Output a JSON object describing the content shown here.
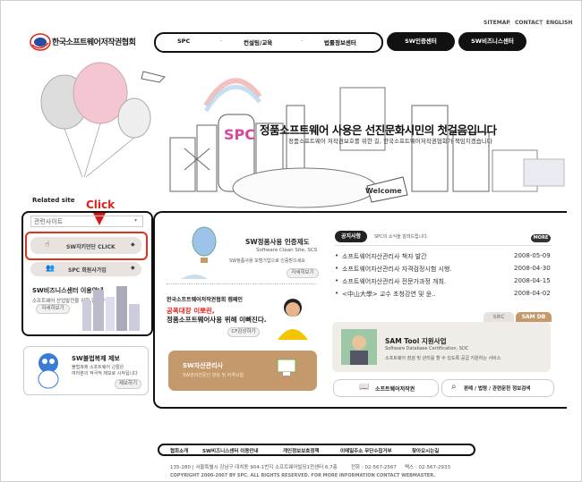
{
  "util_links": [
    "SITEMAP",
    "CONTACT",
    "ENGLISH"
  ],
  "logo_text": "한국소프트웨어저작권협회",
  "nav": {
    "items": [
      "SPC",
      "컨설팅/교육",
      "법률정보센터"
    ]
  },
  "pills": [
    "SW인증센터",
    "SW비즈니스센터"
  ],
  "hero": {
    "headline": "정품소프트웨어 사용은 선진문화시민의 첫걸음입니다",
    "subline": "정품소프트웨어 저작권보호를 위한 길, 한국소프트웨어저작권협회가 책임지겠습니다",
    "building_sign": "SPC",
    "welcome_sign": "Welcome"
  },
  "related": {
    "title": "Related site",
    "select_value": "관련사이트",
    "click_label": "Click",
    "sw_button": "SW지키던단 CLICK",
    "spc_button": "SPC 회원사가입",
    "biz_title": "SW비즈니스센터 이용안내",
    "biz_desc": "소프트웨어 산업발전을 위한 열린공간",
    "biz_btn": "자세히보기"
  },
  "promo1": {
    "title": "SW정품사용 인증제도",
    "subtitle": "Software Clean Site, SCS",
    "desc": "SW정품사용 모범기업으로 인증받으세요",
    "btn": "자세히보기"
  },
  "promo2": {
    "line1": "한국소프트웨어저작권협회 캠페인",
    "line2": "공폭대장 이뽀린,",
    "line3": "정품소프트웨어사용 위해 이뻐진다.",
    "btn": "CF감상하기"
  },
  "promo3": {
    "title": "SW자산관리사",
    "desc": "SW관리전문인 양성 및 자격시험"
  },
  "report": {
    "title": "SW불법복제 제보",
    "desc1": "불법복제 소프트웨어 근절은",
    "desc2": "여러분의 적극적 제보로 시작됩니다",
    "btn": "제보하기"
  },
  "notice": {
    "tab": "공지사항",
    "tab_sub": "SPC의 소식을 알려드립니다.",
    "more": "MORE",
    "rows": [
      {
        "title": "소프트웨어자산관리사 책자 발간",
        "date": "2008-05-09"
      },
      {
        "title": "소프트웨어자산관리사 자격검정시험 시행.",
        "date": "2008-04-30"
      },
      {
        "title": "소프트웨어자산관리사 전문가과정 개최.",
        "date": "2008-04-15"
      },
      {
        "title": "<中山大學> 교수 초청강연 및 윤..",
        "date": "2008-04-02"
      }
    ]
  },
  "sam": {
    "tab_src": "SRC",
    "tab_sam": "SAM DB",
    "title": "SAM Tool 지원사업",
    "subtitle": "Software Database Certification, SDC",
    "desc": "소프트웨어 점검 및 관리를 할 수 있도록 공급 지원하는 서비스"
  },
  "buttons": {
    "author": "소프트웨어저작권",
    "precedent": "판례 / 법령 / 관련문헌 정보검색"
  },
  "footer": {
    "links": [
      "협회소개",
      "SW비즈니스센터 이용안내",
      "개인정보보호정책",
      "이메일주소 무단수집거부",
      "찾아오시는길"
    ],
    "address": "135-280 | 서울특별시 강남구 대치동 904-1번지 소프트웨어빌딩1전센터 6,7층",
    "phone": "전화 : 02-567-2567",
    "fax": "팩스 : 02-567-2933",
    "copyright": "COPYRIGHT 2000-2007 BY SPC.  ALL RIGHTS RESERVED. FOR MORE INFORMATION CONTACT WEBMASTER."
  },
  "colors": {
    "accent": "#e2231a",
    "dark": "#111111",
    "panel": "#c49a6c",
    "soft": "#e9e3df"
  }
}
